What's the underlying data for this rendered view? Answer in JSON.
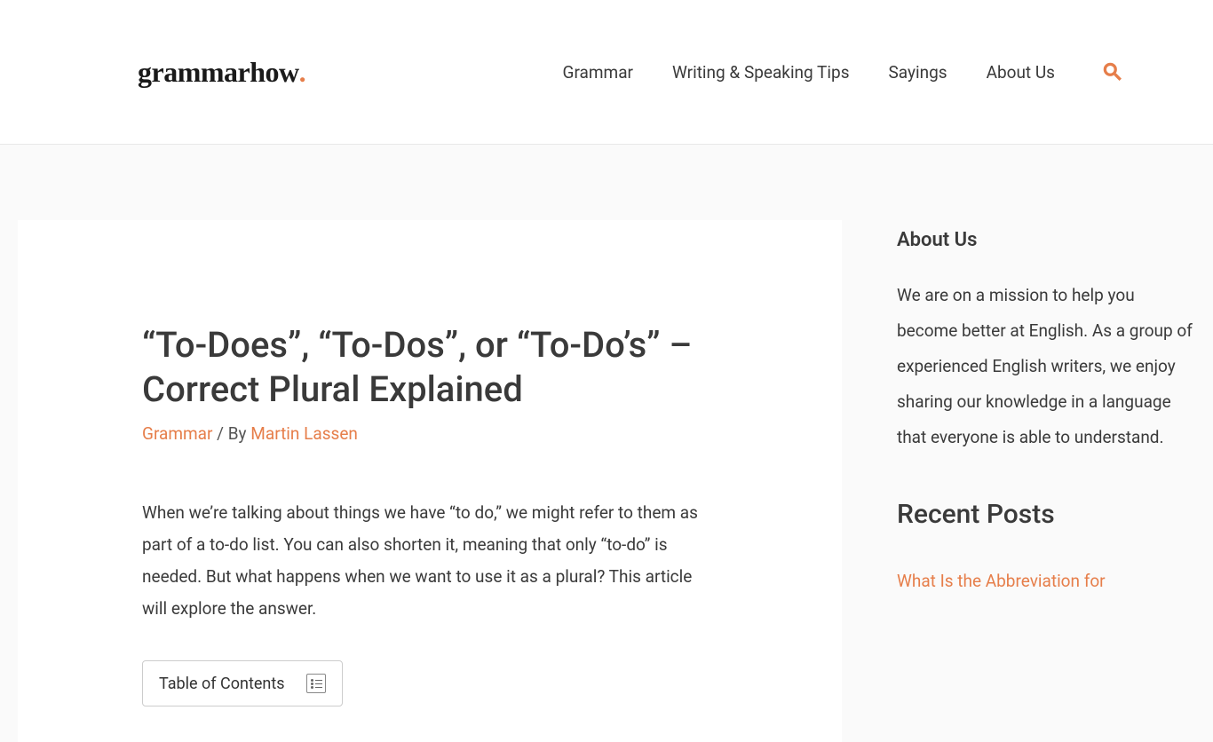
{
  "header": {
    "logo_text": "grammarhow",
    "logo_dot": ".",
    "nav": {
      "grammar": "Grammar",
      "writing": "Writing & Speaking Tips",
      "sayings": "Sayings",
      "about": "About Us"
    }
  },
  "article": {
    "title": "“To-Does”, “To-Dos”, or “To-Do’s” – Correct Plural Explained",
    "category": "Grammar",
    "by_sep": " / By ",
    "author": "Martin Lassen",
    "body": "When we’re talking about things we have “to do,” we might refer to them as part of a to-do list. You can also shorten it, meaning that only “to-do” is needed. But what happens when we want to use it as a plural? This article will explore the answer.",
    "toc_label": "Table of Contents"
  },
  "sidebar": {
    "about": {
      "title": "About Us",
      "text": "We are on a mission to help you become better at English. As a group of experienced English writers, we enjoy sharing our knowledge in a language that everyone is able to understand."
    },
    "recent": {
      "title": "Recent Posts",
      "items": {
        "0": "What Is the Abbreviation for"
      }
    }
  }
}
